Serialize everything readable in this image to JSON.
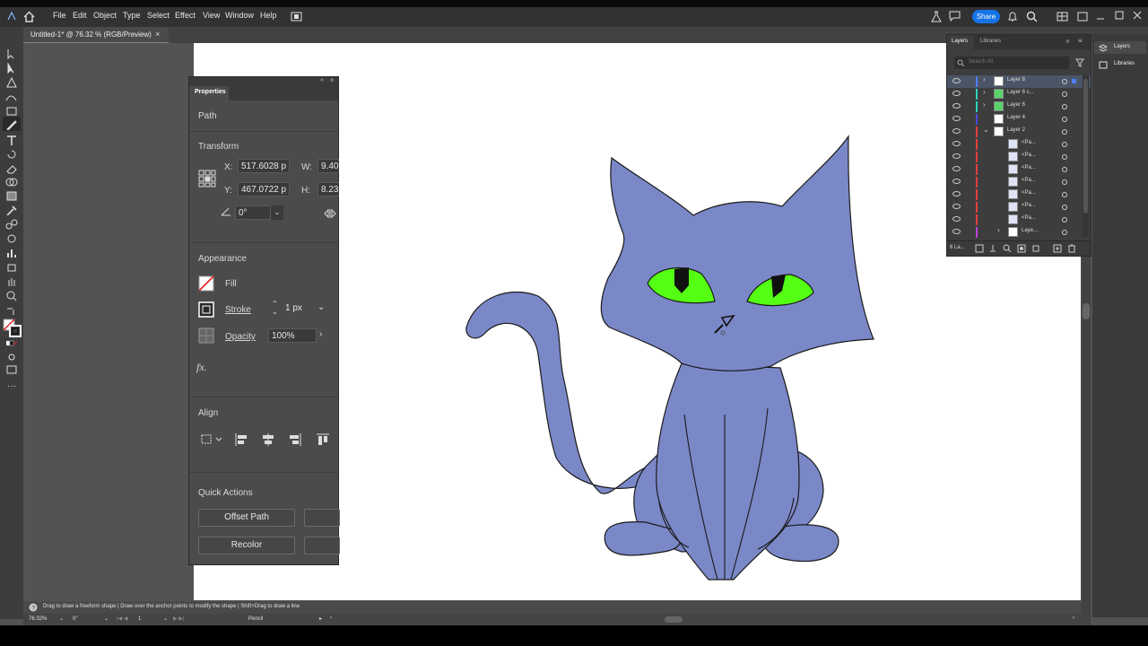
{
  "menu": {
    "items": [
      "File",
      "Edit",
      "Object",
      "Type",
      "Select",
      "Effect",
      "View",
      "Window",
      "Help"
    ],
    "share_label": "Share"
  },
  "document": {
    "tab_title": "Untitled-1* @ 76.32 % (RGB/Preview)",
    "close_glyph": "×"
  },
  "properties": {
    "panel_title": "Properties",
    "selection_type": "Path",
    "transform": {
      "heading": "Transform",
      "x_label": "X:",
      "x_value": "517.6028 p",
      "y_label": "Y:",
      "y_value": "467.0722 p",
      "w_label": "W:",
      "w_value": "9.40",
      "h_label": "H:",
      "h_value": "8.23",
      "angle_value": "0°"
    },
    "appearance": {
      "heading": "Appearance",
      "fill_label": "Fill",
      "stroke_label": "Stroke",
      "stroke_value": "1 px",
      "opacity_label": "Opacity",
      "opacity_value": "100%",
      "fx_label": "fx."
    },
    "align": {
      "heading": "Align"
    },
    "quick_actions": {
      "heading": "Quick Actions",
      "offset_path": "Offset Path",
      "recolor": "Recolor"
    }
  },
  "layers_panel": {
    "tabs": [
      "Layers",
      "Libraries"
    ],
    "search_placeholder": "Search All",
    "rows": [
      {
        "name": "Layer 8",
        "color": "#4f7fff",
        "expand": "›"
      },
      {
        "name": "Layer 6 c...",
        "color": "#2fd0c0",
        "expand": "›"
      },
      {
        "name": "Layer 6",
        "color": "#2fd0c0",
        "expand": "›"
      },
      {
        "name": "Layer 4",
        "color": "#4a4adf",
        "expand": ""
      },
      {
        "name": "Layer 2",
        "color": "#e04040",
        "expand": "⌄"
      },
      {
        "name": "<Pa...",
        "color": "#e04040",
        "expand": ""
      },
      {
        "name": "<Pa...",
        "color": "#e04040",
        "expand": ""
      },
      {
        "name": "<Pa...",
        "color": "#e04040",
        "expand": ""
      },
      {
        "name": "<Pa...",
        "color": "#e04040",
        "expand": ""
      },
      {
        "name": "<Pa...",
        "color": "#e04040",
        "expand": ""
      },
      {
        "name": "<Pa...",
        "color": "#e04040",
        "expand": ""
      },
      {
        "name": "<Pa...",
        "color": "#e04040",
        "expand": ""
      },
      {
        "name": "Laye...",
        "color": "#c040e0",
        "expand": "›"
      }
    ],
    "layer_count": "6 La..."
  },
  "right_dock": {
    "layers_label": "Layers",
    "libraries_label": "Libraries"
  },
  "status": {
    "hint": "Drag to draw a freeform shape  |  Draw over the anchor points to modify the shape  |  Shift+Drag to draw a line",
    "zoom": "76.32%",
    "rotation": "0°",
    "artboard": "1",
    "tool": "Pencil"
  },
  "colors": {
    "cat_fill": "#7b88c8",
    "eye_fill": "#55ff14",
    "accent": "#1473e6"
  }
}
